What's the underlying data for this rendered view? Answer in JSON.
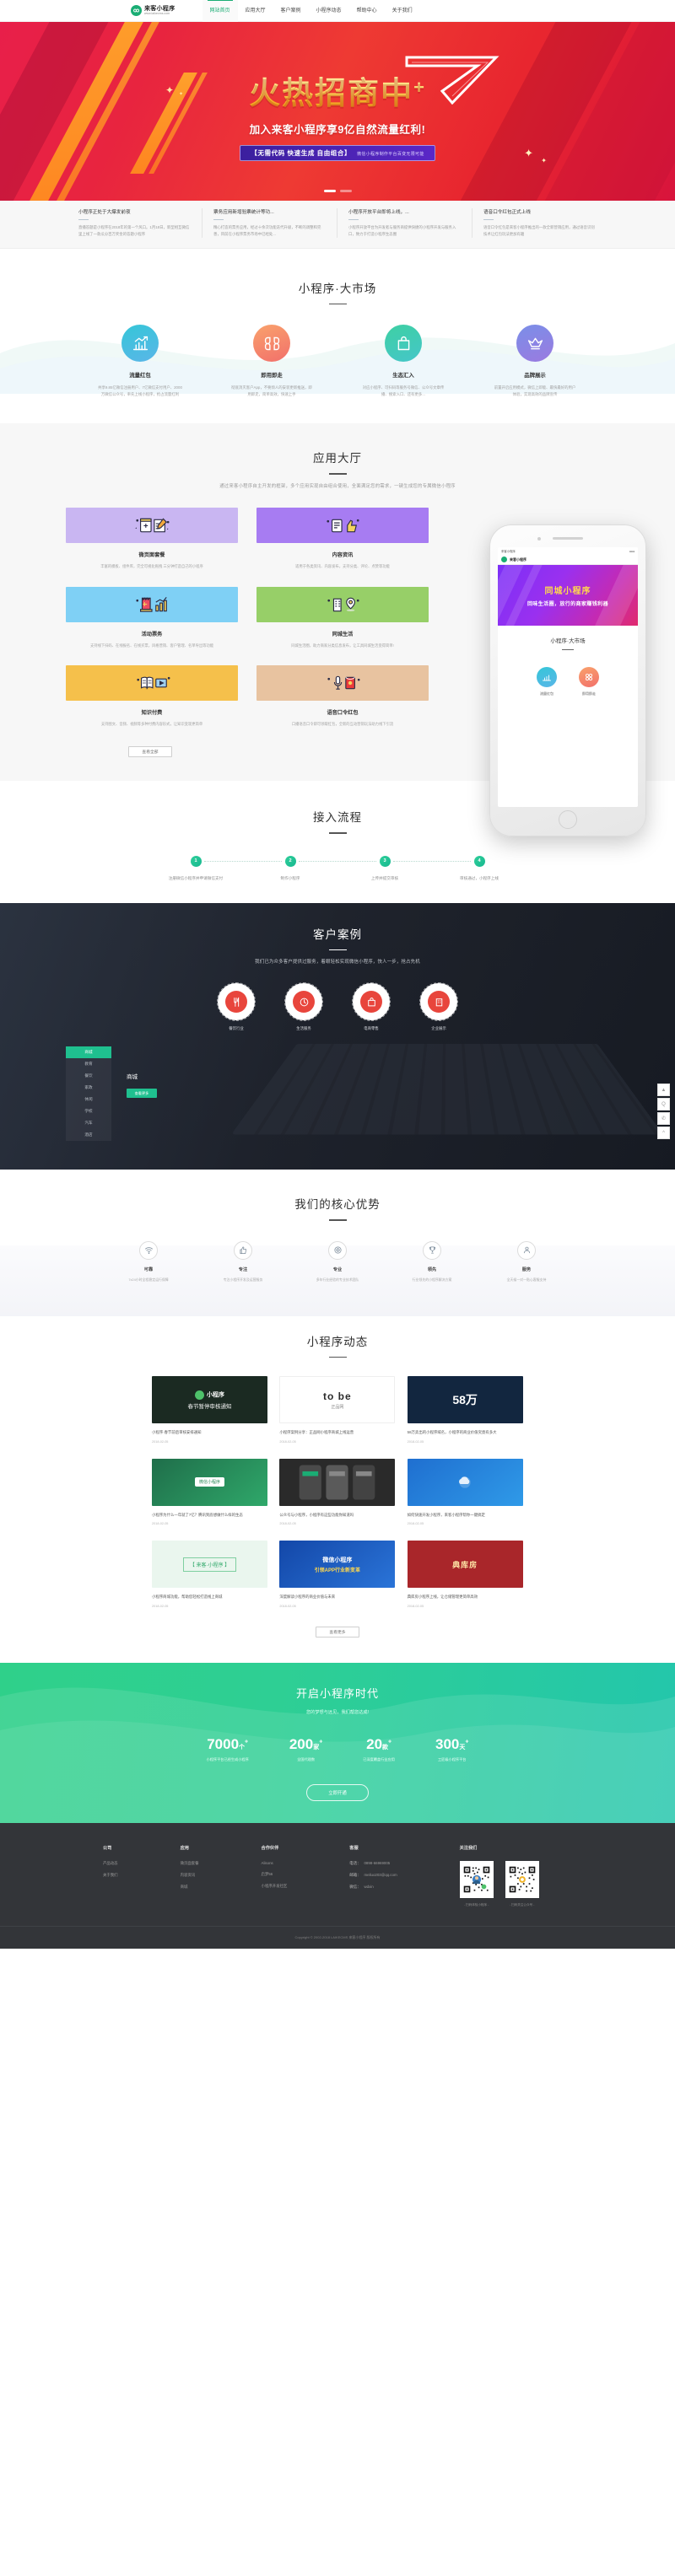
{
  "header": {
    "logo_title": "来客小程序",
    "logo_sub": "www.laikecms.com",
    "logo_icon": "infinity-loop-icon",
    "nav": [
      {
        "label": "网站首页",
        "active": true
      },
      {
        "label": "应用大厅",
        "active": false
      },
      {
        "label": "客户案例",
        "active": false
      },
      {
        "label": "小程序动态",
        "active": false
      },
      {
        "label": "帮助中心",
        "active": false
      },
      {
        "label": "关于我们",
        "active": false
      }
    ]
  },
  "hero": {
    "headline": "火热招商中",
    "plus": "+",
    "subline": "加入来客小程序享9亿自然流量红利!",
    "tag_main": "【无需代码  快速生成  自由组合】",
    "tag_sub": "微信小程序制作平台百变无限可能",
    "dots": 2
  },
  "news_strip": [
    {
      "title": "小程序正处于大爆发前夜",
      "desc": "直播答题是小程序在2018年的第一个风口。1月18日，新型相互微信里上线了一款瓜分百万奖金的答题小程序"
    },
    {
      "title": "票务应用新增验票统计等功...",
      "desc": "精心打造的票务应用，经过十余次功能迭代升级，不断的调整和完善，目前在小程序票务市场中已经处..."
    },
    {
      "title": "小程序开放平台即将上线，...",
      "desc": "小程序开放平台为开发者与服务商提供快捷的小程序开发与服务入口，致力于打造小程序生态圈"
    },
    {
      "title": "语音口令红包正式上线",
      "desc": "语音口令红包是来客小程序推出的一款全新营销应用，通过语音识别技术让红包玩法更加有趣"
    }
  ],
  "market": {
    "title": "小程序·大市场",
    "items": [
      {
        "icon": "chart-growth-icon",
        "name": "流量红包",
        "desc": "共享9.85亿微信注册用户、7亿微信支付用户、2000万微信公众号，率先上线小程序，抢占流量红利",
        "color_a": "#35c6d8",
        "color_b": "#5ab6e8"
      },
      {
        "icon": "grid-apps-icon",
        "name": "即用即走",
        "desc": "彻底消灭客户App，不要烦人的安装更新推送，即用即走，简单高效，快速上手",
        "color_a": "#f9a26c",
        "color_b": "#f2706b"
      },
      {
        "icon": "shopping-bag-icon",
        "name": "生态汇入",
        "desc": "对应小程序、可扫码等服务号微信、公众号文章传播、搜索入口、还有更多...",
        "color_a": "#3ed0a3",
        "color_b": "#45c6c9"
      },
      {
        "icon": "crown-icon",
        "name": "品牌展示",
        "desc": "前置开启应用模式，微信上即能、最快最好的用户体验，实现高效的品牌宣传",
        "color_a": "#7a8fe8",
        "color_b": "#9b7ae0"
      }
    ]
  },
  "hall": {
    "title": "应用大厅",
    "subtitle": "通过来客小程序自主开发的框架，多个应用实现自由组合使用，全面满足您的需求，一键生成您的专属微信小程序",
    "cards": [
      {
        "name": "微页面套餐",
        "desc": "丰富的模板、组件库，完全可视化拖拽 三分钟打造自己的小程序",
        "bg": "#c9b6f2",
        "icon": "notepad-pencil-icon"
      },
      {
        "name": "内容资讯",
        "desc": "适用于各类资讯、内容发布，支持分类、评论、点赞等功能",
        "bg": "#a77cf2",
        "icon": "thumbs-up-icon"
      },
      {
        "name": "活动票务",
        "desc": "支持线下扫码、在线报名、在线买票，风格营销、客户管理、名单导出等功能",
        "bg": "#7fd0f5",
        "icon": "ticket-chart-icon"
      },
      {
        "name": "同城生活",
        "desc": "同城生活圈，助力商家分类信息发布，让工具同城生活变得简单!",
        "bg": "#97cf68",
        "icon": "building-location-icon"
      },
      {
        "name": "知识付费",
        "desc": "支持图文、音频、视频等多种付费内容形式，让知识变现更简单",
        "bg": "#f5c04b",
        "icon": "book-video-icon"
      },
      {
        "name": "语音口令红包",
        "desc": "口播语音口令即可领取红包，全新的互动营销玩法助力线下引流",
        "bg": "#e8c3a0",
        "icon": "mic-redpacket-icon"
      }
    ],
    "more_label": "查看全部"
  },
  "phone": {
    "status_left": "来客小程序",
    "status_right": "●●●",
    "nav_title": "来客小程序",
    "hero_title": "同城小程序",
    "hero_sub": "回味生活圈，放行的商家赚钱利器",
    "sec_title": "小程序·大市场",
    "icons": [
      {
        "label": "流量红包",
        "icon": "chart-growth-icon",
        "color_a": "#35c6d8",
        "color_b": "#5ab6e8"
      },
      {
        "label": "即用即走",
        "icon": "grid-apps-icon",
        "color_a": "#f9a26c",
        "color_b": "#f2706b"
      }
    ]
  },
  "side_float": [
    {
      "icon": "chevron-up-icon",
      "glyph": "▲"
    },
    {
      "icon": "qq-icon",
      "glyph": "Q"
    },
    {
      "icon": "wechat-icon",
      "glyph": "✆"
    },
    {
      "icon": "back-to-top-icon",
      "glyph": "^"
    }
  ],
  "process": {
    "title": "接入流程",
    "steps": [
      {
        "n": "1",
        "label": "注册微信小程序并申请微信支付"
      },
      {
        "n": "2",
        "label": "制作小程序"
      },
      {
        "n": "3",
        "label": "上传并提交审核"
      },
      {
        "n": "4",
        "label": "审核通过，小程序上线"
      }
    ]
  },
  "cases": {
    "title": "客户案例",
    "subtitle": "我们已为众多客户提供过服务，着眼轻松实现微信小程序，快人一步，抢占先机",
    "circles": [
      {
        "label": "餐饮行业",
        "icon": "restaurant-icon",
        "color": "#e8453c"
      },
      {
        "label": "生活服务",
        "icon": "service-icon",
        "color": "#e8453c"
      },
      {
        "label": "电商零售",
        "icon": "retail-icon",
        "color": "#e8453c"
      },
      {
        "label": "企业展示",
        "icon": "enterprise-icon",
        "color": "#e8453c"
      }
    ],
    "tabs": [
      {
        "label": "商城",
        "active": true
      },
      {
        "label": "教育",
        "active": false
      },
      {
        "label": "餐饮",
        "active": false
      },
      {
        "label": "家政",
        "active": false
      },
      {
        "label": "休闲",
        "active": false
      },
      {
        "label": "学校",
        "active": false
      },
      {
        "label": "汽车",
        "active": false
      },
      {
        "label": "酒店",
        "active": false
      }
    ],
    "panel_title": "商城",
    "panel_btn": "查看更多"
  },
  "advantage": {
    "title": "我们的核心优势",
    "items": [
      {
        "icon": "wifi-signal-icon",
        "title": "可靠",
        "desc": "7x24小时全程稳定运行保障"
      },
      {
        "icon": "thumbs-up-icon",
        "title": "专注",
        "desc": "专注小程序开发及运营服务"
      },
      {
        "icon": "target-icon",
        "title": "专业",
        "desc": "多年行业经验的专业技术团队"
      },
      {
        "icon": "trophy-icon",
        "title": "领先",
        "desc": "行业领先的小程序解决方案"
      },
      {
        "icon": "user-support-icon",
        "title": "服务",
        "desc": "全天候一对一贴心客服支持"
      }
    ]
  },
  "news_section": {
    "title": "小程序动态",
    "cards": [
      {
        "thumb_kind": "dark-green",
        "thumb_text_a": "小程序",
        "thumb_text_b": "春节暂停审核通知",
        "title": "小程序·春节前后审核安排通知",
        "date": "2018-02-05"
      },
      {
        "thumb_kind": "tobe",
        "thumb_text_a": "to be",
        "thumb_text_b": "正品网",
        "title": "小程序案例分享：正品网小程序商城上线运营",
        "date": "2018-02-05"
      },
      {
        "thumb_kind": "blue-num",
        "thumb_text_a": "58万",
        "thumb_text_b": "",
        "title": "58万卖出的小程序域名，小程序的商业价值究竟有多大",
        "date": "2018-02-05"
      },
      {
        "thumb_kind": "green-card",
        "thumb_text_a": "微信小程序",
        "thumb_text_b": "",
        "title": "小程序为什么一年就了7亿？腾讯到底想做什么样的生态",
        "date": "2018-02-05"
      },
      {
        "thumb_kind": "phone-grid",
        "thumb_text_a": "",
        "thumb_text_b": "",
        "title": "公众号与小程序，小程序有这些功能你知道吗",
        "date": "2018-02-05"
      },
      {
        "thumb_kind": "blue-cloud",
        "thumb_text_a": "",
        "thumb_text_b": "",
        "title": "如何快速开发小程序，来客小程序帮你一键搞定",
        "date": "2018-02-05"
      },
      {
        "thumb_kind": "green-frame",
        "thumb_text_a": "【 来客·小程序 】",
        "thumb_text_b": "",
        "title": "小程序商城功能，帮助您轻松打造线上商城",
        "date": "2018-02-05"
      },
      {
        "thumb_kind": "blue-banner",
        "thumb_text_a": "微信小程序",
        "thumb_text_b": "引领APP行业新变革",
        "title": "深度解读小程序的商业价值与未来",
        "date": "2018-02-05"
      },
      {
        "thumb_kind": "red-book",
        "thumb_text_a": "典库房",
        "thumb_text_b": "",
        "title": "典库房小程序上线，让仓储管理更简单高效",
        "date": "2018-02-05"
      }
    ],
    "more_label": "查看更多"
  },
  "cta": {
    "title": "开启小程序时代",
    "subtitle": "您的梦想与远见，我们帮您达成!",
    "stats": [
      {
        "num": "7000",
        "unit": "个",
        "sup": "+",
        "label": "小程序平台已经生成小程序"
      },
      {
        "num": "200",
        "unit": "家",
        "sup": "+",
        "label": "全国代理数"
      },
      {
        "num": "20",
        "unit": "款",
        "sup": "+",
        "label": "已深度覆盖行业应用"
      },
      {
        "num": "300",
        "unit": "天",
        "sup": "+",
        "label": "工匠级小程序平台"
      }
    ],
    "button": "立即开通"
  },
  "footer": {
    "columns": [
      {
        "heading": "公司",
        "links": [
          "产品动态",
          "关于我们"
        ]
      },
      {
        "heading": "应用",
        "links": [
          "微页面套餐",
          "内容资讯",
          "商城"
        ]
      },
      {
        "heading": "合作伙伴",
        "links": [
          "Alisons",
          "启梦56",
          "小程序开发社区"
        ]
      }
    ],
    "contact": {
      "heading": "客服",
      "rows": [
        {
          "k": "电话：",
          "v": "0898-66969005"
        },
        {
          "k": "邮箱：",
          "v": "meiluo203@qq.com"
        },
        {
          "k": "微信：",
          "v": "wdxin"
        }
      ]
    },
    "follow": {
      "heading": "关注我们",
      "qrs": [
        {
          "caption": "- 扫码体验小程序 -",
          "name": "wechat-miniprogram-qr"
        },
        {
          "caption": "- 扫码关注公众号 -",
          "name": "wechat-official-qr"
        }
      ]
    },
    "copyright": "Copyright © 2002-2018 LAIKECMS 来客小程序 版权所有"
  }
}
